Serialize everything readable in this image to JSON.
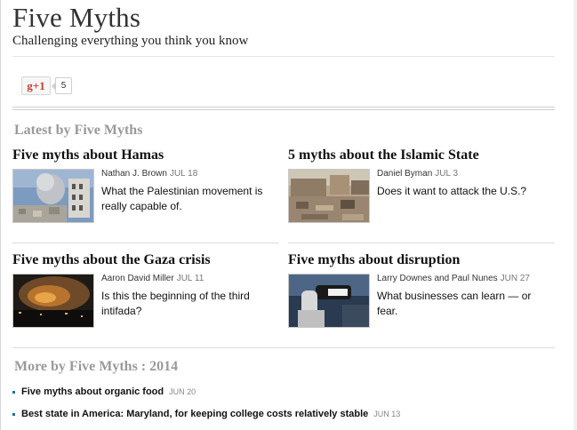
{
  "header": {
    "title": "Five Myths",
    "tagline": "Challenging everything you think you know"
  },
  "social": {
    "gplus_label": "g+1",
    "gplus_count": "5"
  },
  "latest": {
    "heading": "Latest by Five Myths",
    "stories": [
      {
        "title": "Five myths about Hamas",
        "author": "Nathan J. Brown",
        "date": "JUL 18",
        "summary": "What the Palestinian movement is really capable of."
      },
      {
        "title": "5 myths about the Islamic State",
        "author": "Daniel Byman",
        "date": "JUL 3",
        "summary": "Does it want to attack the U.S.?"
      },
      {
        "title": "Five myths about the Gaza crisis",
        "author": "Aaron David Miller",
        "date": "JUL 11",
        "summary": "Is this the beginning of the third intifada?"
      },
      {
        "title": "Five myths about disruption",
        "author": "Larry Downes and Paul Nunes",
        "date": "JUN 27",
        "summary": "What businesses can learn — or fear."
      }
    ]
  },
  "more": {
    "heading": "More by Five Myths : 2014",
    "items": [
      {
        "title": "Five myths about organic food",
        "date": "JUN 20"
      },
      {
        "title": "Best state in America: Maryland, for keeping college costs relatively stable",
        "date": "JUN 13"
      }
    ]
  },
  "colors": {
    "heading_gray": "#9a9a9a",
    "gplus_red": "#c63d2d",
    "bullet_blue": "#1a6fb0"
  }
}
